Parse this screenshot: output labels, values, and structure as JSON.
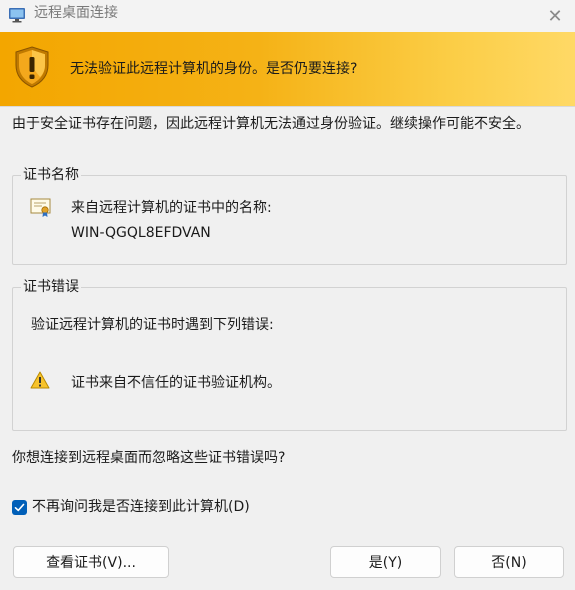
{
  "window": {
    "title": "远程桌面连接",
    "app_icon": "remote-desktop-icon",
    "close_icon": "close-icon"
  },
  "banner": {
    "icon": "warning-shield-icon",
    "message": "无法验证此远程计算机的身份。是否仍要连接?",
    "colors": {
      "start": "#f3a600",
      "end": "#ffd966"
    }
  },
  "intro": "由于安全证书存在问题，因此远程计算机无法通过身份验证。继续操作可能不安全。",
  "certificate_name_group": {
    "legend": "证书名称",
    "icon": "certificate-icon",
    "label": "来自远程计算机的证书中的名称:",
    "value": "WIN-QGQL8EFDVAN"
  },
  "certificate_errors_group": {
    "legend": "证书错误",
    "description": "验证远程计算机的证书时遇到下列错误:",
    "icon": "warning-icon",
    "error": "证书来自不信任的证书验证机构。"
  },
  "question": "你想连接到远程桌面而忽略这些证书错误吗?",
  "dont_ask_checkbox": {
    "label": "不再询问我是否连接到此计算机(D)",
    "checked": true,
    "color": "#005fb8"
  },
  "buttons": {
    "view_certificate": "查看证书(V)...",
    "yes": "是(Y)",
    "no": "否(N)"
  }
}
